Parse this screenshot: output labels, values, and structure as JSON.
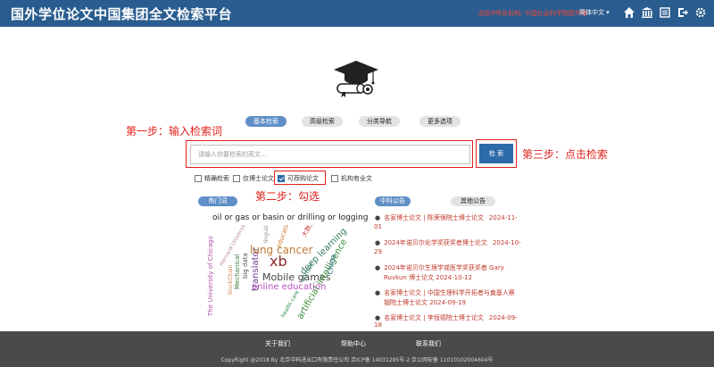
{
  "header": {
    "app_title": "国外学位论文中国集团全文检索平台",
    "org_label": "当前IP所处机构: 中国社会科学院图书馆",
    "language": "简体中文 ▾"
  },
  "icons": [
    "home-icon",
    "institution-icon",
    "list-icon",
    "logout-icon",
    "settings-icon"
  ],
  "tabs": [
    "基本检索",
    "高级检索",
    "分类导航",
    "更多选项"
  ],
  "annotations": {
    "step1": "第一步：输入检索词",
    "step2": "第二步：勾选",
    "step3": "第三步：点击检索"
  },
  "search": {
    "placeholder": "请输入你要检索的英文...",
    "button": "检 索"
  },
  "options": [
    "精确检索",
    "仅博士论文",
    "可荐购论文",
    "机构有全文"
  ],
  "hot": {
    "label": "热门词",
    "query": "oil or gas or basin or drilling or logging",
    "cloud_words": [
      "lung cancer",
      "Mobile games",
      "online education",
      "deep learning",
      "artificial intelligence",
      "The University of Chicago",
      "translator",
      "Mechanical",
      "big data",
      "linguistics",
      "education",
      "Harvard University",
      "BlockChain",
      "China",
      "sensor",
      "health care",
      "大数据",
      "xb"
    ]
  },
  "news_tabs": [
    "中科公告",
    "其他公告"
  ],
  "news": [
    {
      "title": "名家博士论文 | 陈荣保院士博士论文",
      "date": "2024-11-",
      "cont": "01"
    },
    {
      "title": "2024年诺贝尔化学奖获奖者博士论文",
      "date": "2024-10-",
      "cont": "29"
    },
    {
      "title": "2024年诺贝尔生理学或医学奖获奖者 Gary",
      "date": "",
      "cont": "Ruvkun 博士论文   2024-10-12"
    },
    {
      "title": "名家博士论文 | 中国生理科学开拓者与奠基人蔡",
      "date": "",
      "cont": "翘院士博士论文   2024-09-19"
    },
    {
      "title": "名家博士论文 | 李恒德院士博士论文",
      "date": "2024-09-",
      "cont": "18"
    }
  ],
  "footer": {
    "links": [
      "关于我们",
      "帮助中心",
      "联系我们"
    ],
    "copyright": "CopyRight @2018 By 北京中科进出口有限责任公司 京ICP备 14031295号-2   京公网安备 11010102004604号"
  },
  "colors": {
    "header_bg": "#2a5d8f",
    "accent": "#2d6aa8",
    "annotation": "#e0201b",
    "footer_bg": "#4a4a4a"
  }
}
